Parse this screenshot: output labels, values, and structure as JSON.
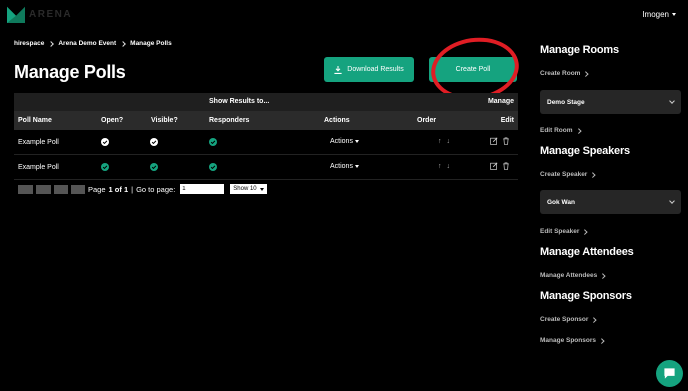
{
  "app": {
    "logo_text": "ARENA"
  },
  "user_menu": {
    "name": "Imogen"
  },
  "breadcrumb": [
    "hirespace",
    "Arena Demo Event",
    "Manage Polls"
  ],
  "page": {
    "title": "Manage Polls"
  },
  "buttons": {
    "download": "Download Results",
    "create": "Create Poll"
  },
  "table": {
    "group_header": "Show Results to...",
    "manage_header": "Manage",
    "columns": [
      "Poll Name",
      "Open?",
      "Visible?",
      "Responders",
      "Actions",
      "Order",
      "Edit"
    ],
    "rows": [
      {
        "name": "Example Poll",
        "actions": "Actions"
      },
      {
        "name": "Example Poll",
        "actions": "Actions"
      }
    ]
  },
  "pager": {
    "page_label": "Page",
    "page_current": "1 of 1",
    "separator": "|",
    "goto_label": "Go to page:",
    "goto_value": "1",
    "show_value": "Show 10"
  },
  "sidebar": {
    "rooms_heading": "Manage Rooms",
    "create_room": "Create Room",
    "room_selected": "Demo Stage",
    "edit_room": "Edit Room",
    "speakers_heading": "Manage Speakers",
    "create_speaker": "Create Speaker",
    "speaker_selected": "Gok Wan",
    "edit_speaker": "Edit Speaker",
    "attendees_heading": "Manage Attendees",
    "manage_attendees": "Manage Attendees",
    "sponsors_heading": "Manage Sponsors",
    "create_sponsor": "Create Sponsor",
    "manage_sponsors": "Manage Sponsors"
  },
  "colors": {
    "accent": "#15a37f",
    "highlight": "#e01d24",
    "background": "#000000"
  },
  "icons": [
    "arena-logo-icon",
    "download-icon",
    "check-icon",
    "green-check-icon",
    "arrow-up-icon",
    "arrow-down-icon",
    "edit-icon",
    "trash-icon",
    "chat-icon"
  ]
}
